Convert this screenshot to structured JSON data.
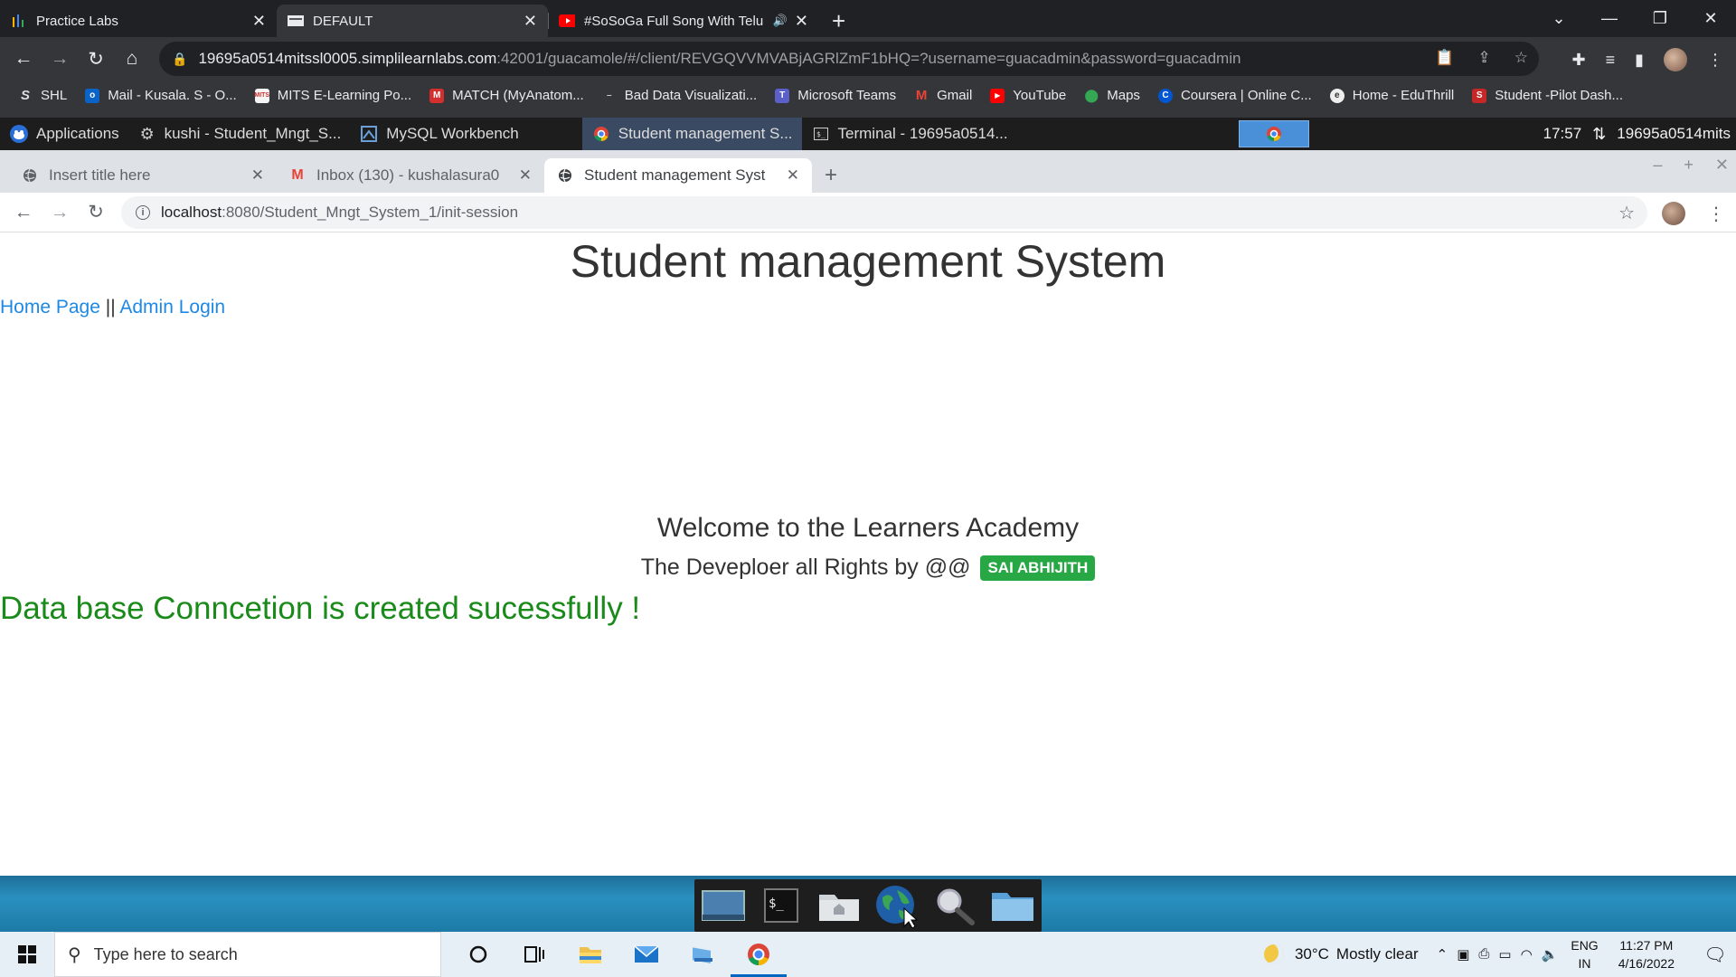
{
  "outer_browser": {
    "tabs": [
      {
        "label": "Practice Labs",
        "icon": "practice-labs-icon"
      },
      {
        "label": "DEFAULT",
        "icon": "default-page-icon"
      },
      {
        "label": "#SoSoGa Full Song With Telu",
        "icon": "youtube-icon"
      }
    ],
    "url_host": "19695a0514mitssl0005.simplilearnlabs.com",
    "url_rest": ":42001/guacamole/#/client/REVGQVVMVABjAGRlZmF1bHQ=?username=guacadmin&password=guacadmin",
    "bookmarks": [
      "SHL",
      "Mail - Kusala. S - O...",
      "MITS E-Learning Po...",
      "MATCH (MyAnatom...",
      "Bad Data Visualizati...",
      "Microsoft Teams",
      "Gmail",
      "YouTube",
      "Maps",
      "Coursera | Online C...",
      "Home - EduThrill",
      "Student -Pilot Dash..."
    ]
  },
  "remote_panel": {
    "applications": "Applications",
    "windows": [
      "kushi - Student_Mngt_S...",
      "MySQL Workbench",
      "Student management S...",
      "Terminal - 19695a0514..."
    ],
    "time": "17:57",
    "user": "19695a0514mits"
  },
  "inner_browser": {
    "tabs": [
      {
        "label": "Insert title here"
      },
      {
        "label": "Inbox (130) - kushalasura0"
      },
      {
        "label": "Student management Syst"
      }
    ],
    "url_host": "localhost",
    "url_path": ":8080/Student_Mngt_System_1/init-session"
  },
  "page": {
    "title": "Student management System",
    "nav_home": "Home Page",
    "nav_sep": "||",
    "nav_admin": "Admin Login",
    "welcome": "Welcome to the Learners Academy",
    "developer_text": "The Deveploer all Rights by @@",
    "developer_badge": "SAI ABHIJITH",
    "db_message": "Data base Conncetion is created sucessfully !"
  },
  "taskbar": {
    "search_placeholder": "Type here to search",
    "weather_temp": "30°C",
    "weather_desc": "Mostly clear",
    "lang_1": "ENG",
    "lang_2": "IN",
    "time": "11:27 PM",
    "date": "4/16/2022"
  },
  "colors": {
    "link": "#1e88e5",
    "success_text": "#1a8a1a",
    "badge_bg": "#28a745"
  }
}
